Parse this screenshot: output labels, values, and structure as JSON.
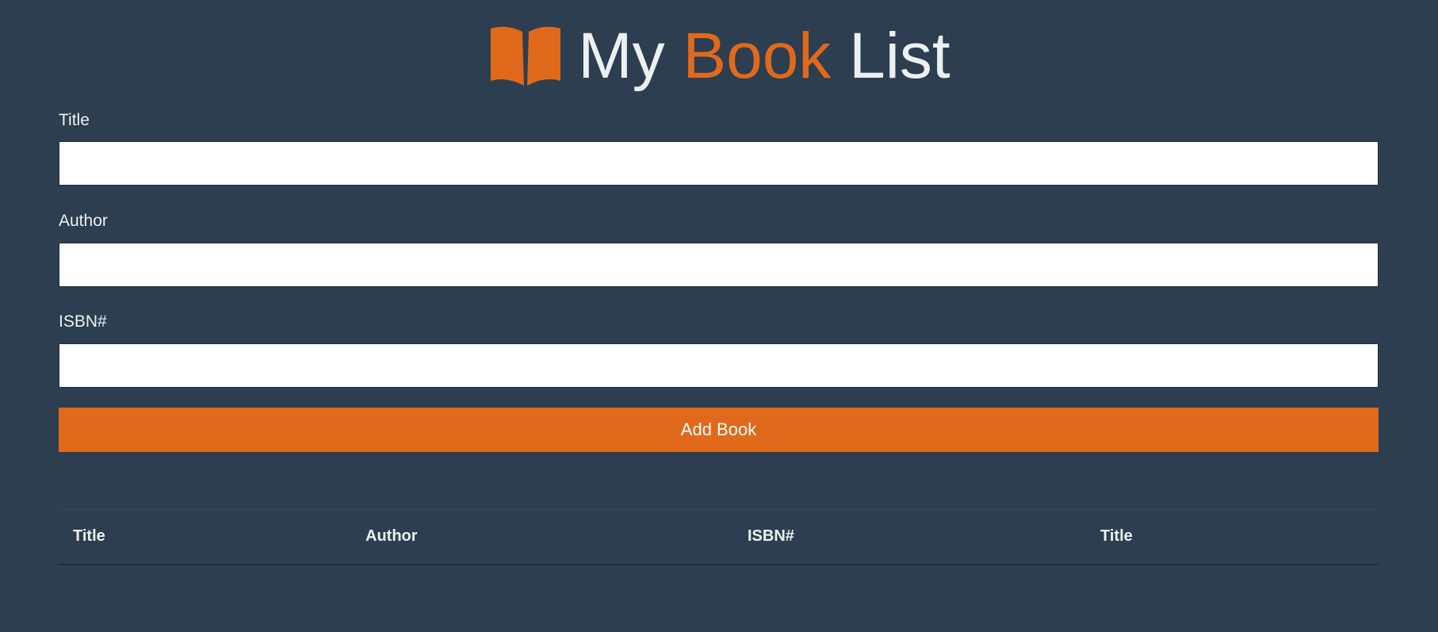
{
  "header": {
    "logo_icon": "open-book-icon",
    "title_word_1": "My",
    "title_word_2": "Book",
    "title_word_3": "List"
  },
  "form": {
    "title_label": "Title",
    "title_value": "",
    "author_label": "Author",
    "author_value": "",
    "isbn_label": "ISBN#",
    "isbn_value": "",
    "submit_label": "Add Book"
  },
  "table": {
    "columns": [
      "Title",
      "Author",
      "ISBN#",
      "Title"
    ],
    "rows": []
  },
  "colors": {
    "background": "#2c3e50",
    "accent": "#e0691b",
    "text": "#ecf0f1"
  }
}
